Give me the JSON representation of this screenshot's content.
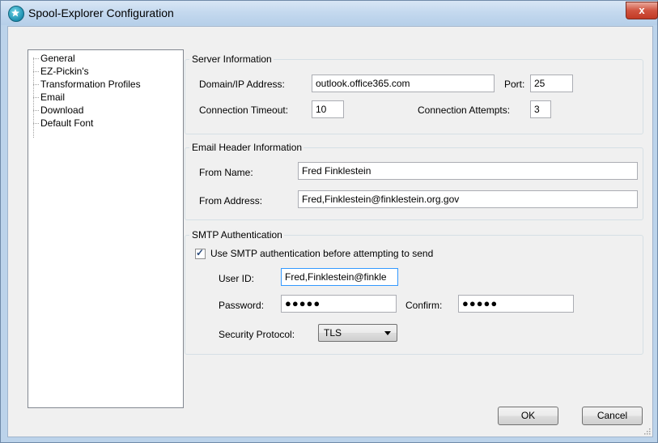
{
  "window": {
    "title": "Spool-Explorer Configuration",
    "close_label": "x"
  },
  "tree": {
    "items": [
      "General",
      "EZ-Pickin's",
      "Transformation Profiles",
      "Email",
      "Download",
      "Default Font"
    ]
  },
  "server": {
    "legend": "Server Information",
    "domain_label": "Domain/IP Address:",
    "domain_value": "outlook.office365.com",
    "port_label": "Port:",
    "port_value": "25",
    "timeout_label": "Connection Timeout:",
    "timeout_value": "10",
    "attempts_label": "Connection Attempts:",
    "attempts_value": "3"
  },
  "header": {
    "legend": "Email Header Information",
    "from_name_label": "From Name:",
    "from_name_value": "Fred Finklestein",
    "from_address_label": "From Address:",
    "from_address_value": "Fred,Finklestein@finklestein.org.gov"
  },
  "smtp": {
    "legend": "SMTP Authentication",
    "use_auth_label": "Use SMTP authentication before attempting to send",
    "use_auth_checked": true,
    "userid_label": "User ID:",
    "userid_value": "Fred,Finklestein@finkle",
    "password_label": "Password:",
    "password_value": "●●●●●",
    "confirm_label": "Confirm:",
    "confirm_value": "●●●●●",
    "security_label": "Security Protocol:",
    "security_value": "TLS"
  },
  "buttons": {
    "ok": "OK",
    "cancel": "Cancel"
  }
}
